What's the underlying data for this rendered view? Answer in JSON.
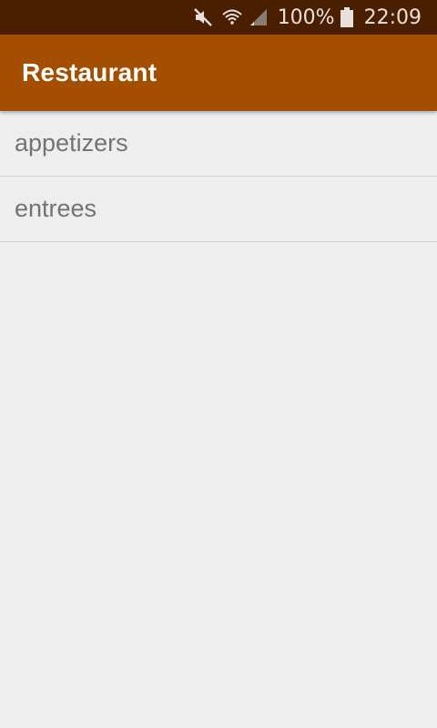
{
  "status_bar": {
    "battery_percent": "100%",
    "time": "22:09",
    "icons": [
      "mute-icon",
      "wifi-icon",
      "signal-icon",
      "battery-icon"
    ]
  },
  "app_bar": {
    "title": "Restaurant"
  },
  "menu": {
    "items": [
      {
        "label": "appetizers"
      },
      {
        "label": "entrees"
      }
    ]
  },
  "colors": {
    "status_bar_bg": "#4a1f00",
    "app_bar_bg": "#a44e00",
    "background": "#eeeeee",
    "item_text": "#737373"
  }
}
